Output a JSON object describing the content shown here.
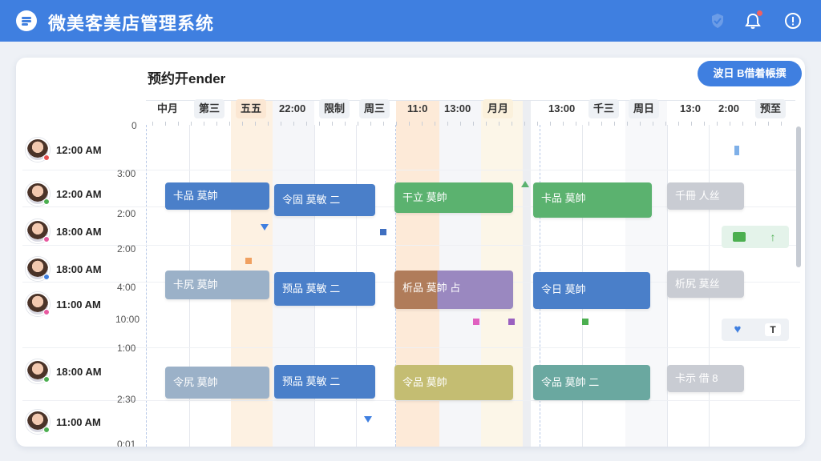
{
  "topbar": {
    "title": "微美客美店管理系统",
    "icons": [
      "menu-logo-icon",
      "shield-icon",
      "bell-icon",
      "info-icon"
    ],
    "accent": "#3f7fe0"
  },
  "calendar": {
    "title": "预约开ender",
    "action_button": "波日 B借着帳撰"
  },
  "columns": [
    "中月",
    "第三",
    "五五",
    "22:00",
    "限制",
    "周三",
    "11:0",
    "13:00",
    "月月",
    "13:00",
    "千三",
    "周日",
    "13:0",
    "2:00",
    "预至"
  ],
  "y_labels": [
    "0",
    "3:00",
    "2:00",
    "2:00",
    "4:00",
    "10:00",
    "1:00",
    "2:30",
    "0:01"
  ],
  "staff": [
    {
      "time": "12:00 AM",
      "status_color": "#e85050"
    },
    {
      "time": "12:00 AM",
      "status_color": "#4caf50"
    },
    {
      "time": "18:00 AM",
      "status_color": "#e85aa0"
    },
    {
      "time": "18:00 AM",
      "status_color": "#3f7fe0"
    },
    {
      "time": "11:00 AM",
      "status_color": "#e85aa0"
    },
    {
      "time": "18:00 AM",
      "status_color": "#4caf50"
    },
    {
      "time": "11:00 AM",
      "status_color": "#4caf50"
    }
  ],
  "appointments": [
    {
      "label": "卡品 莫帥",
      "color": "#4a7fc9"
    },
    {
      "label": "令固 莫敏 二",
      "color": "#4a7fc9"
    },
    {
      "label": "干立 莫帥",
      "color": "#5bb26f"
    },
    {
      "label": "卡品 莫帥",
      "color": "#5bb26f"
    },
    {
      "label": "千冊 人丝",
      "color": "#c9ccd3"
    },
    {
      "label": "卡尻 莫帥",
      "color": "#9bb1c8"
    },
    {
      "label": "预品 莫敏 二",
      "color": "#4a7fc9"
    },
    {
      "label": "析品 莫帥 占",
      "color": "#9a88c0"
    },
    {
      "label": "令日 莫帥",
      "color": "#4a7fc9"
    },
    {
      "label": "析尻 莫丝",
      "color": "#c9ccd3"
    },
    {
      "label": "令尻 莫帥",
      "color": "#9bb1c8"
    },
    {
      "label": "预品 莫敏 二",
      "color": "#4a7fc9"
    },
    {
      "label": "令品 莫帥",
      "color": "#c4bd72"
    },
    {
      "label": "令品 莫帥 二",
      "color": "#6aa8a0"
    },
    {
      "label": "卡示 借 8",
      "color": "#c9ccd3"
    }
  ],
  "side_tools": {
    "row1": [
      "folder-icon",
      "arrow-up-icon"
    ],
    "row2": [
      "heart-icon",
      "text-icon"
    ]
  }
}
